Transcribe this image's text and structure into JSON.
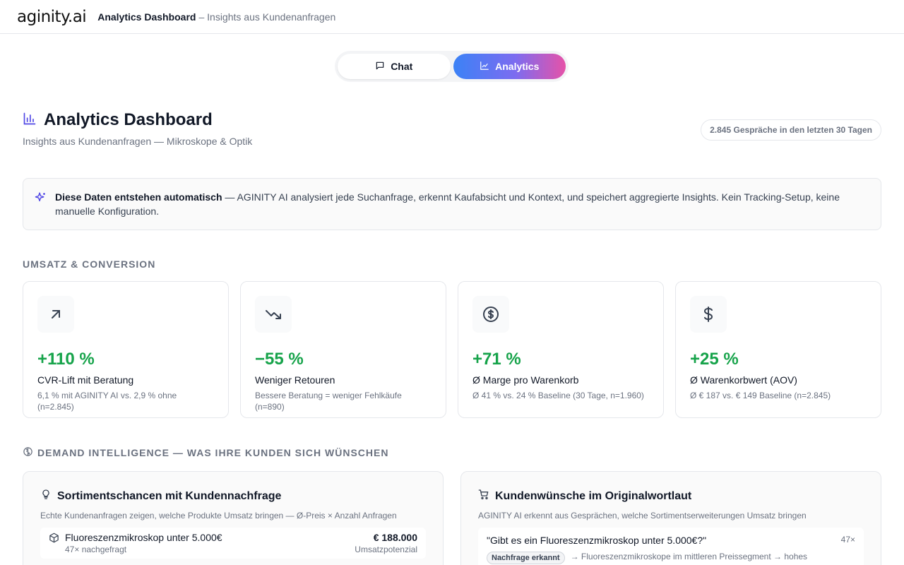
{
  "header": {
    "logo": "aginity.ai",
    "title": "Analytics Dashboard",
    "subtitle": "– Insights aus Kundenanfragen"
  },
  "toggle": {
    "chat_label": "Chat",
    "analytics_label": "Analytics",
    "active": "Analytics"
  },
  "page": {
    "title": "Analytics Dashboard",
    "subtitle": "Insights aus Kundenanfragen — Mikroskope & Optik",
    "pill": "2.845 Gespräche in den letzten 30 Tagen"
  },
  "banner": {
    "bold": "Diese Daten entstehen automatisch",
    "text": " — AGINITY AI analysiert jede Suchanfrage, erkennt Kaufabsicht und Kontext, und speichert aggregierte Insights. Kein Tracking-Setup, keine manuelle Konfiguration."
  },
  "section_revenue": "UMSATZ & CONVERSION",
  "kpis": [
    {
      "icon": "arrow-up-right-icon",
      "value": "+110 %",
      "label": "CVR-Lift mit Beratung",
      "note": "6,1 % mit AGINITY AI vs. 2,9 % ohne (n=2.845)"
    },
    {
      "icon": "trending-down-icon",
      "value": "−55 %",
      "label": "Weniger Retouren",
      "note": "Bessere Beratung = weniger Fehlkäufe (n=890)"
    },
    {
      "icon": "dollar-circle-icon",
      "value": "+71 %",
      "label": "Ø Marge pro Warenkorb",
      "note": "Ø 41 % vs. 24 % Baseline (30 Tage, n=1.960)"
    },
    {
      "icon": "dollar-icon",
      "value": "+25 %",
      "label": "Ø Warenkorbwert (AOV)",
      "note": "Ø € 187 vs. € 149 Baseline (n=2.845)"
    }
  ],
  "colors": {
    "positive": "#16a34a",
    "accent_start": "#3b82f6",
    "accent_end": "#e652a8"
  },
  "section_demand": "DEMAND INTELLIGENCE — WAS IHRE KUNDEN SICH WÜNSCHEN",
  "panel_left": {
    "title": "Sortimentschancen mit Kundennachfrage",
    "subtitle": "Echte Kundenanfragen zeigen, welche Produkte Umsatz bringen — Ø-Preis × Anzahl Anfragen",
    "rows": [
      {
        "name": "Fluoreszenzmikroskop unter 5.000€",
        "count": "47× nachgefragt",
        "value": "€ 188.000",
        "unit": "Umsatzpotenzial"
      }
    ]
  },
  "panel_right": {
    "title": "Kundenwünsche im Originalwortlaut",
    "subtitle": "AGINITY AI erkennt aus Gesprächen, welche Sortimentserweiterungen Umsatz bringen",
    "quotes": [
      {
        "text": "\"Gibt es ein Fluoreszenzmikroskop unter 5.000€?\"",
        "count": "47×",
        "badge": "Nachfrage erkannt",
        "note": "→ Fluoreszenzmikroskope im mittleren Preissegment → hohes"
      }
    ]
  }
}
